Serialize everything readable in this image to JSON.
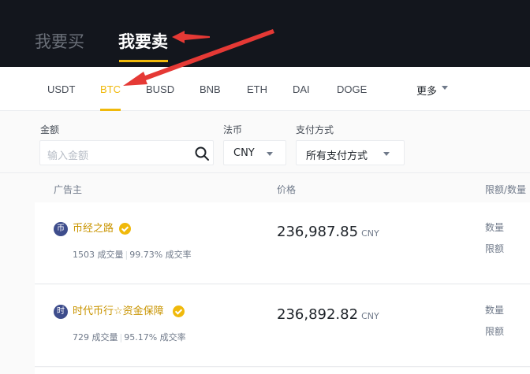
{
  "tabs": {
    "buy": "我要买",
    "sell": "我要卖"
  },
  "coins": [
    "USDT",
    "BTC",
    "BUSD",
    "BNB",
    "ETH",
    "DAI",
    "DOGE"
  ],
  "active_coin": "BTC",
  "more_label": "更多",
  "filters": {
    "amount_label": "金额",
    "amount_placeholder": "输入金额",
    "fiat_label": "法币",
    "fiat_value": "CNY",
    "payment_label": "支付方式",
    "payment_value": "所有支付方式"
  },
  "table_headers": {
    "advertiser": "广告主",
    "price": "价格",
    "limits": "限额/数量"
  },
  "rows": [
    {
      "avatar": "币",
      "name": "币经之路",
      "orders": "1503 成交量",
      "rate": "99.73% 成交率",
      "price": "236,987.85",
      "currency": "CNY",
      "qty_label": "数量",
      "limit_label": "限额"
    },
    {
      "avatar": "时",
      "name": "时代币行☆资金保障",
      "orders": "729 成交量",
      "rate": "95.17% 成交率",
      "price": "236,892.82",
      "currency": "CNY",
      "qty_label": "数量",
      "limit_label": "限额"
    }
  ],
  "colors": {
    "accent": "#f0b90b",
    "header_bg": "#13161d",
    "annotation_arrow": "#e53935"
  }
}
